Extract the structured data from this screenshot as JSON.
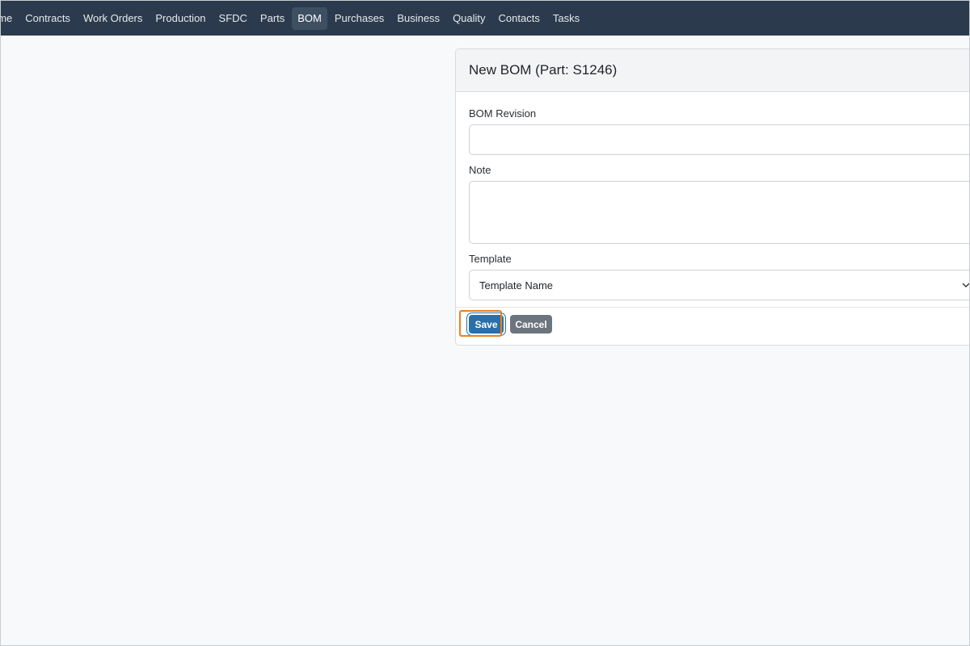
{
  "nav": {
    "items": [
      {
        "label": "ome"
      },
      {
        "label": "Contracts"
      },
      {
        "label": "Work Orders"
      },
      {
        "label": "Production"
      },
      {
        "label": "SFDC"
      },
      {
        "label": "Parts"
      },
      {
        "label": "BOM",
        "active": true
      },
      {
        "label": "Purchases"
      },
      {
        "label": "Business"
      },
      {
        "label": "Quality"
      },
      {
        "label": "Contacts"
      },
      {
        "label": "Tasks"
      }
    ]
  },
  "form": {
    "title": "New BOM (Part: S1246)",
    "bom_revision": {
      "label": "BOM Revision",
      "value": ""
    },
    "note": {
      "label": "Note",
      "value": ""
    },
    "template": {
      "label": "Template",
      "selected": "Template Name"
    },
    "save_label": "Save",
    "cancel_label": "Cancel"
  },
  "colors": {
    "navbar": "#2b3b4d",
    "save_button": "#2a6fa8",
    "cancel_button": "#6c757d",
    "focus_highlight": "#f07f1a"
  },
  "icons": {
    "template_dropdown": "chevron-down-icon"
  }
}
